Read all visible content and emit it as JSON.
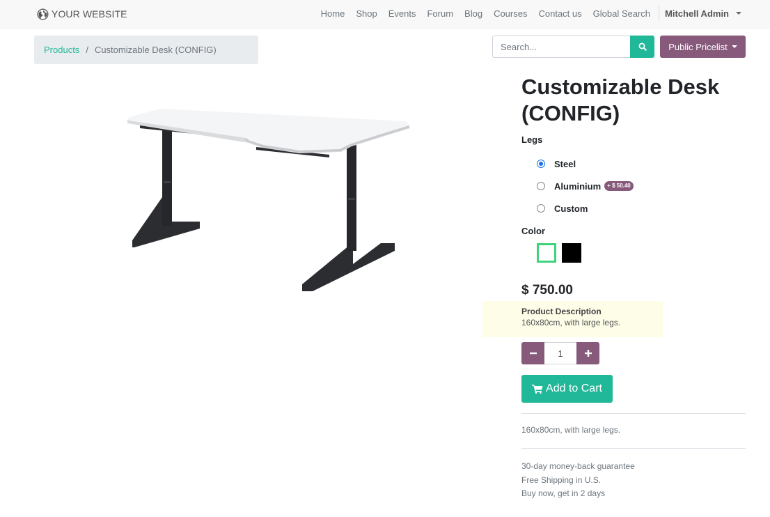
{
  "brand": {
    "name": "YOUR WEBSITE",
    "icon": "globe-icon"
  },
  "nav": {
    "links": [
      "Home",
      "Shop",
      "Events",
      "Forum",
      "Blog",
      "Courses",
      "Contact us",
      "Global Search"
    ],
    "user": "Mitchell Admin"
  },
  "breadcrumb": {
    "parent": "Products",
    "separator": "/",
    "current": "Customizable Desk (CONFIG)"
  },
  "search": {
    "placeholder": "Search...",
    "button_icon": "search-icon"
  },
  "pricelist": {
    "label": "Public Pricelist"
  },
  "product": {
    "title": "Customizable Desk (CONFIG)",
    "legs_label": "Legs",
    "legs_options": [
      {
        "label": "Steel",
        "selected": true
      },
      {
        "label": "Aluminium",
        "price_extra": "+ $ 50.40",
        "selected": false
      },
      {
        "label": "Custom",
        "selected": false
      }
    ],
    "color_label": "Color",
    "colors": [
      {
        "name": "White",
        "hex": "#ffffff",
        "selected": true
      },
      {
        "name": "Black",
        "hex": "#000000",
        "selected": false
      }
    ],
    "price": "$ 750.00",
    "description_title": "Product Description",
    "description_text": "160x80cm, with large legs.",
    "quantity": "1",
    "add_to_cart": "Add to Cart",
    "short_description": "160x80cm, with large legs.",
    "guarantees": [
      "30-day money-back guarantee",
      "Free Shipping in U.S.",
      "Buy now, get in 2 days"
    ]
  },
  "colors": {
    "primary": "#875a7b",
    "accent": "#21b799",
    "selected_swatch": "#3fd47b"
  }
}
